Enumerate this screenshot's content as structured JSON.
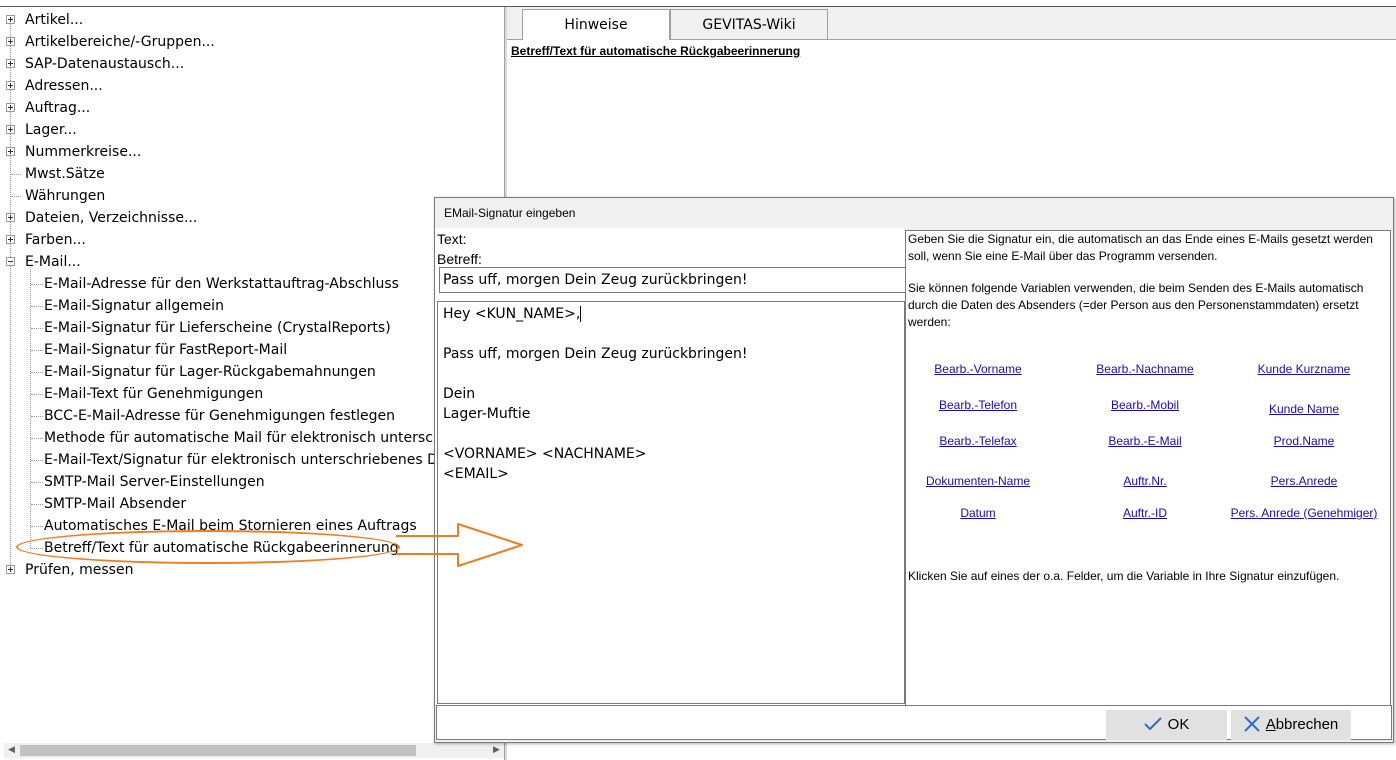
{
  "tree": {
    "items": [
      {
        "label": "Artikel...",
        "level": 0,
        "expander": "plus"
      },
      {
        "label": "Artikelbereiche/-Gruppen...",
        "level": 0,
        "expander": "plus"
      },
      {
        "label": "SAP-Datenaustausch...",
        "level": 0,
        "expander": "plus"
      },
      {
        "label": "Adressen...",
        "level": 0,
        "expander": "plus"
      },
      {
        "label": "Auftrag...",
        "level": 0,
        "expander": "plus"
      },
      {
        "label": "Lager...",
        "level": 0,
        "expander": "plus"
      },
      {
        "label": "Nummerkreise...",
        "level": 0,
        "expander": "plus"
      },
      {
        "label": "Mwst.Sätze",
        "level": 0,
        "expander": "none"
      },
      {
        "label": "Währungen",
        "level": 0,
        "expander": "none"
      },
      {
        "label": "Dateien, Verzeichnisse...",
        "level": 0,
        "expander": "plus"
      },
      {
        "label": "Farben...",
        "level": 0,
        "expander": "plus"
      },
      {
        "label": "E-Mail...",
        "level": 0,
        "expander": "minus"
      },
      {
        "label": "E-Mail-Adresse für den Werkstattauftrag-Abschluss",
        "level": 1,
        "expander": "none"
      },
      {
        "label": "E-Mail-Signatur allgemein",
        "level": 1,
        "expander": "none"
      },
      {
        "label": "E-Mail-Signatur für Lieferscheine (CrystalReports)",
        "level": 1,
        "expander": "none"
      },
      {
        "label": "E-Mail-Signatur für FastReport-Mail",
        "level": 1,
        "expander": "none"
      },
      {
        "label": "E-Mail-Signatur für Lager-Rückgabemahnungen",
        "level": 1,
        "expander": "none"
      },
      {
        "label": "E-Mail-Text für Genehmigungen",
        "level": 1,
        "expander": "none"
      },
      {
        "label": "BCC-E-Mail-Adresse für Genehmigungen festlegen",
        "level": 1,
        "expander": "none"
      },
      {
        "label": "Methode für automatische Mail für elektronisch unterschrieb",
        "level": 1,
        "expander": "none"
      },
      {
        "label": "E-Mail-Text/Signatur für elektronisch unterschriebenes Doku",
        "level": 1,
        "expander": "none"
      },
      {
        "label": "SMTP-Mail Server-Einstellungen",
        "level": 1,
        "expander": "none"
      },
      {
        "label": "SMTP-Mail Absender",
        "level": 1,
        "expander": "none"
      },
      {
        "label": "Automatisches E-Mail beim Stornieren eines Auftrags",
        "level": 1,
        "expander": "none"
      },
      {
        "label": "Betreff/Text für automatische Rückgabeerinnerung",
        "level": 1,
        "expander": "none"
      },
      {
        "label": "Prüfen, messen",
        "level": 0,
        "expander": "plus"
      }
    ]
  },
  "tabs": [
    {
      "label": "Hinweise",
      "active": true
    },
    {
      "label": "GEVITAS-Wiki",
      "active": false
    }
  ],
  "hint": {
    "title": "Betreff/Text für automatische  Rückgabeerinnerung"
  },
  "dialog": {
    "title": "EMail-Signatur eingeben",
    "text_label": "Text:",
    "betreff_label": "Betreff:",
    "betreff_value": "Pass uff, morgen Dein Zeug zurückbringen!",
    "body_lines": [
      "Hey <KUN_NAME>,",
      "",
      "Pass uff, morgen Dein Zeug zurückbringen!",
      "",
      "Dein",
      "Lager-Muftie",
      "",
      "<VORNAME> <NACHNAME>",
      "<EMAIL>"
    ],
    "help_intro": "Geben Sie die Signatur ein, die automatisch an das Ende eines E-Mails gesetzt werden soll, wenn Sie eine E-Mail über das Programm versenden.",
    "help_vars": "Sie können folgende Variablen verwenden, die beim Senden des E-Mails automatisch durch die Daten des Absenders (=der Person aus den Personenstammdaten) ersetzt werden:",
    "help_footer": "Klicken Sie auf eines der o.a. Felder, um die Variable in Ihre Signatur einzufügen.",
    "variables": [
      {
        "label": "Bearb.-Vorname"
      },
      {
        "label": "Bearb.-Nachname"
      },
      {
        "label": "Kunde Kurzname"
      },
      {
        "label": "Bearb.-Telefon"
      },
      {
        "label": "Bearb.-Mobil"
      },
      {
        "label": "Kunde Name"
      },
      {
        "label": "Bearb.-Telefax"
      },
      {
        "label": "Bearb.-E-Mail"
      },
      {
        "label": "Prod.Name"
      },
      {
        "label": "Dokumenten-Name"
      },
      {
        "label": "Auftr.Nr."
      },
      {
        "label": "Pers.Anrede"
      },
      {
        "label": "Datum"
      },
      {
        "label": "Auftr.-ID"
      },
      {
        "label": "Pers. Anrede (Genehmiger)"
      }
    ],
    "ok_label": "OK",
    "cancel_label": "Abbrechen"
  },
  "colors": {
    "annotation": "#ef7d22",
    "link": "#1a0dab",
    "check": "#2a6ebf",
    "cross": "#2a6ebf"
  }
}
